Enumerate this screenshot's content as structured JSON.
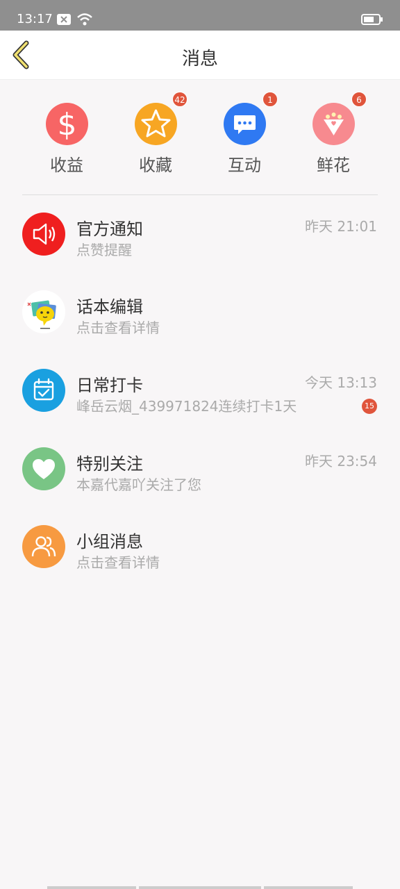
{
  "status_bar": {
    "time": "13:17"
  },
  "header": {
    "title": "消息"
  },
  "quick_actions": [
    {
      "label": "收益",
      "icon": "dollar-icon",
      "color": "#f76565",
      "badge": ""
    },
    {
      "label": "收藏",
      "icon": "star-icon",
      "color": "#f7a623",
      "badge": "42"
    },
    {
      "label": "互动",
      "icon": "chat-icon",
      "color": "#2f79f2",
      "badge": "1"
    },
    {
      "label": "鲜花",
      "icon": "flower-icon",
      "color": "#f78a8f",
      "badge": "6"
    }
  ],
  "messages": [
    {
      "name": "官方通知",
      "subtitle": "点赞提醒",
      "time": "昨天 21:01",
      "badge": "",
      "icon": "speaker-icon",
      "color": "#ef1f1f"
    },
    {
      "name": "话本编辑",
      "subtitle": "点击查看详情",
      "time": "",
      "badge": "",
      "icon": "editor-avatar",
      "color": "#ffffff"
    },
    {
      "name": "日常打卡",
      "subtitle": "峰岳云烟_439971824连续打卡1天",
      "time": "今天 13:13",
      "badge": "15",
      "icon": "calendar-icon",
      "color": "#1aa0e0"
    },
    {
      "name": "特别关注",
      "subtitle": "本嘉代嘉吖关注了您",
      "time": "昨天 23:54",
      "badge": "",
      "icon": "heart-icon",
      "color": "#79c585"
    },
    {
      "name": "小组消息",
      "subtitle": "点击查看详情",
      "time": "",
      "badge": "",
      "icon": "group-icon",
      "color": "#f79a41"
    }
  ]
}
